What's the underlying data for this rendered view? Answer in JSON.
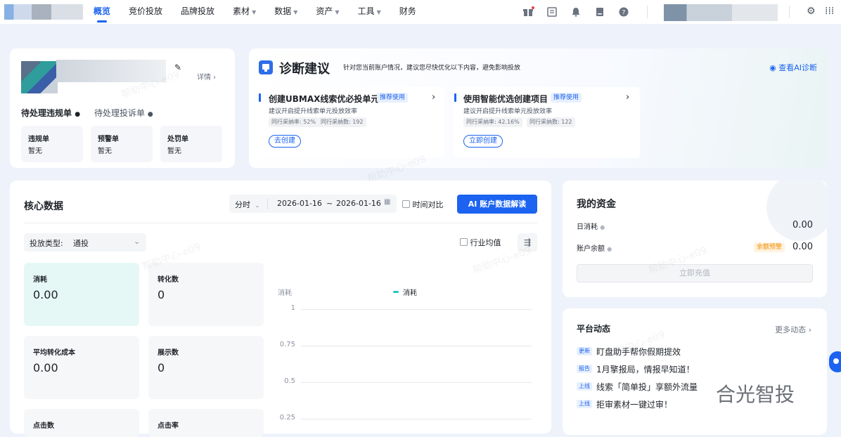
{
  "nav": {
    "items": [
      {
        "label": "概览",
        "active": true,
        "dropdown": false
      },
      {
        "label": "竞价投放",
        "active": false,
        "dropdown": false
      },
      {
        "label": "品牌投放",
        "active": false,
        "dropdown": false
      },
      {
        "label": "素材",
        "active": false,
        "dropdown": true
      },
      {
        "label": "数据",
        "active": false,
        "dropdown": true
      },
      {
        "label": "资产",
        "active": false,
        "dropdown": true
      },
      {
        "label": "工具",
        "active": false,
        "dropdown": true
      },
      {
        "label": "财务",
        "active": false,
        "dropdown": false
      }
    ],
    "icons": [
      "gift-icon",
      "list-icon",
      "bell-icon",
      "file-icon",
      "help-icon"
    ]
  },
  "account": {
    "detail_label": "详情",
    "tabs": [
      "待处理违规单",
      "待处理投诉单"
    ],
    "stats": [
      {
        "label": "违规单",
        "value": "暂无"
      },
      {
        "label": "预警单",
        "value": "暂无"
      },
      {
        "label": "处罚单",
        "value": "暂无"
      }
    ]
  },
  "diagnosis": {
    "title": "诊断建议",
    "subtitle": "针对您当前账户情况，建议您尽快优化以下内容，避免影响投放",
    "ai_link": "查看AI诊断",
    "cards": [
      {
        "title": "创建UBMAX线索优必投单元",
        "tag": "推荐使用",
        "desc": "建议开启提升线索单元投放效率",
        "stat1": "同行采纳率: 52%",
        "stat2": "同行采纳数: 192",
        "button": "去创建"
      },
      {
        "title": "使用智能优选创建项目",
        "tag": "推荐使用",
        "desc": "建议开启提升线索单元投放效率",
        "stat1": "同行采纳率: 42.16%",
        "stat2": "同行采纳数: 122",
        "button": "立即创建"
      }
    ]
  },
  "core": {
    "title": "核心数据",
    "granularity": "分时",
    "date_start": "2026-01-16",
    "date_sep": "~",
    "date_end": "2026-01-16",
    "compare_label": "时间对比",
    "ai_button": "AI 账户数据解读",
    "type_label": "投放类型:",
    "type_value": "通投",
    "industry_avg": "行业均值",
    "metrics": [
      {
        "label": "消耗",
        "value": "0.00",
        "selected": true
      },
      {
        "label": "转化数",
        "value": "0",
        "selected": false
      },
      {
        "label": "平均转化成本",
        "value": "0.00",
        "selected": false
      },
      {
        "label": "展示数",
        "value": "0",
        "selected": false
      },
      {
        "label": "点击数",
        "value": "",
        "selected": false
      },
      {
        "label": "点击率",
        "value": "",
        "selected": false
      }
    ]
  },
  "chart_data": {
    "type": "line",
    "ylabel": "消耗",
    "series": [
      {
        "name": "消耗",
        "values": []
      }
    ],
    "y_ticks": [
      "1",
      "0.75",
      "0.5",
      "0.25"
    ],
    "ylim": [
      0,
      1
    ],
    "legend": "top-center",
    "grid": true,
    "color": "#22c7c7"
  },
  "funds": {
    "title": "我的资金",
    "daily_label": "日消耗",
    "daily_value": "0.00",
    "balance_label": "账户余额",
    "balance_tag": "余额预警",
    "balance_value": "0.00",
    "recharge": "立即充值"
  },
  "news": {
    "title": "平台动态",
    "more": "更多动态",
    "items": [
      {
        "tag": "更新",
        "text": "盯盘助手帮你假期提效"
      },
      {
        "tag": "报告",
        "text": "1月擎报局，情报早知道！"
      },
      {
        "tag": "上线",
        "text": "线索「简单投」享额外流量"
      },
      {
        "tag": "上线",
        "text": "拒审素材一键过审！"
      }
    ]
  },
  "brand": "合光智投",
  "watermark": "帮助中心-e09"
}
